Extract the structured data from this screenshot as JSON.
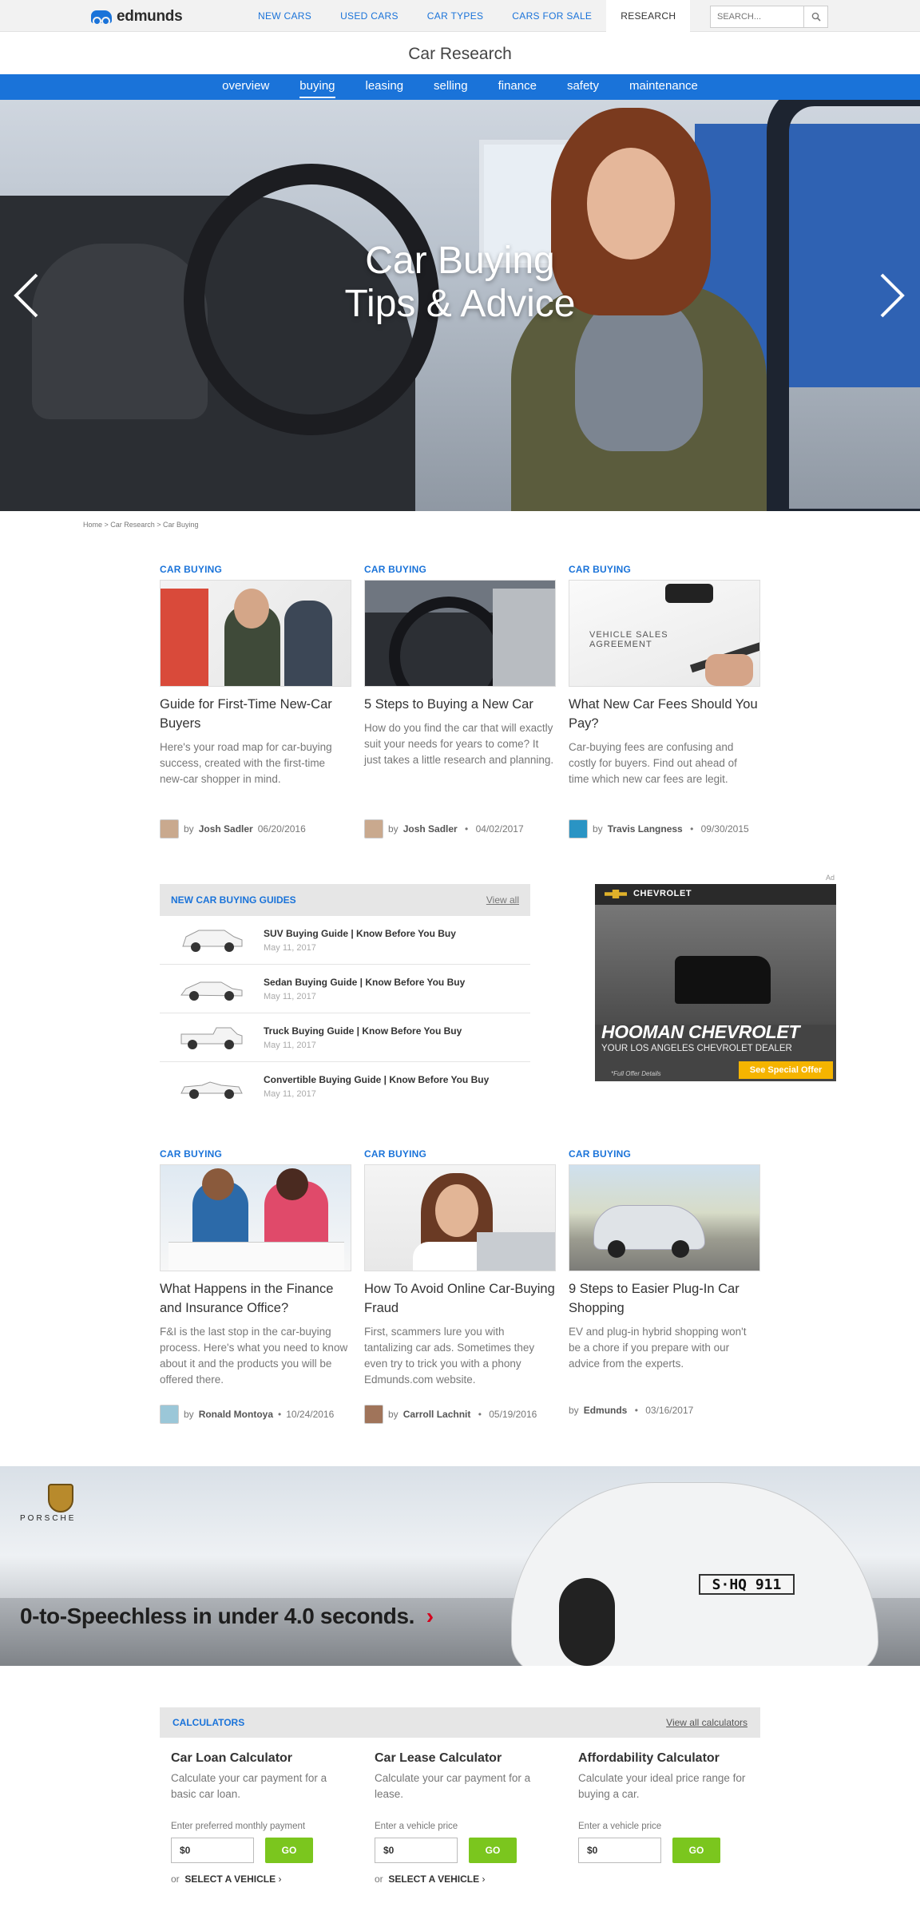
{
  "topbar": {
    "logo": "edmunds",
    "nav": [
      "NEW CARS",
      "USED CARS",
      "CAR TYPES",
      "CARS FOR SALE",
      "RESEARCH"
    ],
    "search_placeholder": "SEARCH..."
  },
  "page_title": "Car Research",
  "subnav": [
    "overview",
    "buying",
    "leasing",
    "selling",
    "finance",
    "safety",
    "maintenance"
  ],
  "hero": {
    "line1": "Car Buying",
    "line2": "Tips & Advice"
  },
  "breadcrumb": "Home  >  Car Research  >  Car Buying",
  "articles_top": [
    {
      "cat": "CAR BUYING",
      "title": "Guide for First-Time New-Car Buyers",
      "desc": "Here's your road map for car-buying success, created with the first-time new-car shopper in mind.",
      "by": "by",
      "author": "Josh Sadler",
      "date": "06/20/2016"
    },
    {
      "cat": "CAR BUYING",
      "title": "5 Steps to Buying a New Car",
      "desc": "How do you find the car that will exactly suit your needs for years to come? It just takes a little research and planning.",
      "by": "by",
      "author": "Josh Sadler",
      "date": "04/02/2017"
    },
    {
      "cat": "CAR BUYING",
      "title": "What New Car Fees Should You Pay?",
      "desc": "Car-buying fees are confusing and costly for buyers. Find out ahead of time which new car fees are legit.",
      "by": "by",
      "author": "Travis Langness",
      "date": "09/30/2015"
    }
  ],
  "guides": {
    "title": "NEW CAR BUYING GUIDES",
    "view_all": "View all",
    "items": [
      {
        "title": "SUV Buying Guide  |  Know Before You Buy",
        "date": "May 11, 2017"
      },
      {
        "title": "Sedan Buying Guide  |  Know Before You Buy",
        "date": "May 11, 2017"
      },
      {
        "title": "Truck Buying Guide  |  Know Before You Buy",
        "date": "May 11, 2017"
      },
      {
        "title": "Convertible Buying Guide  |  Know Before You Buy",
        "date": "May 11, 2017"
      }
    ]
  },
  "ad": {
    "label": "Ad",
    "brand": "CHEVROLET",
    "headline": "HOOMAN CHEVROLET",
    "sub": "YOUR LOS ANGELES CHEVROLET DEALER",
    "fine": "*Full Offer Details",
    "cta": "See Special Offer"
  },
  "articles_bottom": [
    {
      "cat": "CAR BUYING",
      "title": "What Happens in the Finance and Insurance Office?",
      "desc": "F&I is the last stop in the car-buying process. Here's what you need to know about it and the products you will be offered there.",
      "by": "by",
      "author": "Ronald Montoya",
      "date": "10/24/2016"
    },
    {
      "cat": "CAR BUYING",
      "title": "How To Avoid Online Car-Buying Fraud",
      "desc": "First, scammers lure you with tantalizing car ads. Sometimes they even try to trick you with a phony Edmunds.com website.",
      "by": "by",
      "author": "Carroll Lachnit",
      "date": "05/19/2016"
    },
    {
      "cat": "CAR BUYING",
      "title": "9 Steps to Easier Plug-In Car Shopping",
      "desc": "EV and plug-in hybrid shopping won't be a chore if you prepare with our advice from the experts.",
      "by": "by",
      "author": "Edmunds",
      "date": "03/16/2017"
    }
  ],
  "porsche": {
    "brand": "PORSCHE",
    "tagline": "0-to-Speechless in under 4.0 seconds.",
    "plate": "S·HQ 911"
  },
  "calculators": {
    "title": "CALCULATORS",
    "view_all": "View all calculators",
    "items": [
      {
        "name": "Car Loan Calculator",
        "desc": "Calculate your car payment for a basic car loan.",
        "label": "Enter preferred monthly payment",
        "value": "$0",
        "go": "GO",
        "or": "or",
        "select": "SELECT A VEHICLE"
      },
      {
        "name": "Car Lease Calculator",
        "desc": "Calculate your car payment for a lease.",
        "label": "Enter a vehicle price",
        "value": "$0",
        "go": "GO",
        "or": "or",
        "select": "SELECT A VEHICLE"
      },
      {
        "name": "Affordability Calculator",
        "desc": "Calculate your ideal price range for buying a car.",
        "label": "Enter a vehicle price",
        "value": "$0",
        "go": "GO"
      }
    ]
  },
  "colors": {
    "brand_blue": "#1a73d9",
    "go_green": "#7bc61e",
    "ad_cta": "#f5b400"
  }
}
